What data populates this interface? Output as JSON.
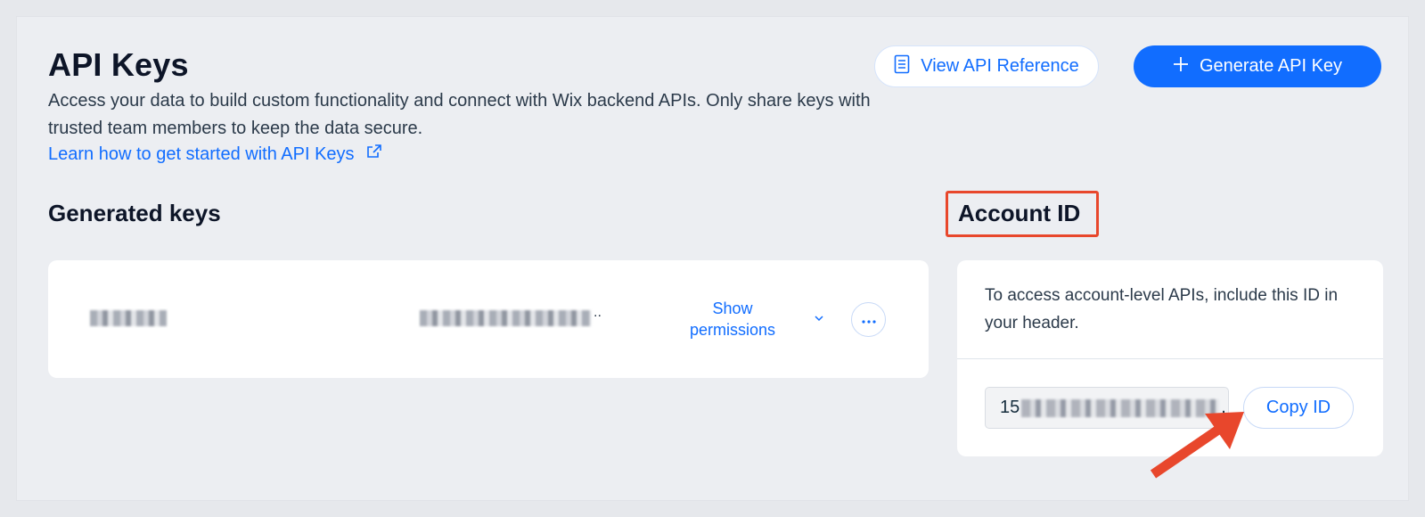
{
  "header": {
    "title": "API Keys",
    "description": "Access your data to build custom functionality and connect with Wix backend APIs. Only share keys with trusted team members to keep the data secure.",
    "learn_link": "Learn how to get started with API Keys",
    "view_reference_label": "View API Reference",
    "generate_label": "Generate API Key"
  },
  "generated_keys": {
    "title": "Generated keys",
    "rows": [
      {
        "name": "",
        "key_suffix": "..",
        "show_permissions_label": "Show permissions",
        "more_label": "..."
      }
    ]
  },
  "account": {
    "title": "Account ID",
    "description": "To access account-level APIs, include this ID in your header.",
    "id_prefix": "15",
    "id_suffix": ".",
    "copy_label": "Copy ID"
  },
  "colors": {
    "accent": "#116dff",
    "highlight": "#e8472c",
    "background": "#eceef2"
  }
}
